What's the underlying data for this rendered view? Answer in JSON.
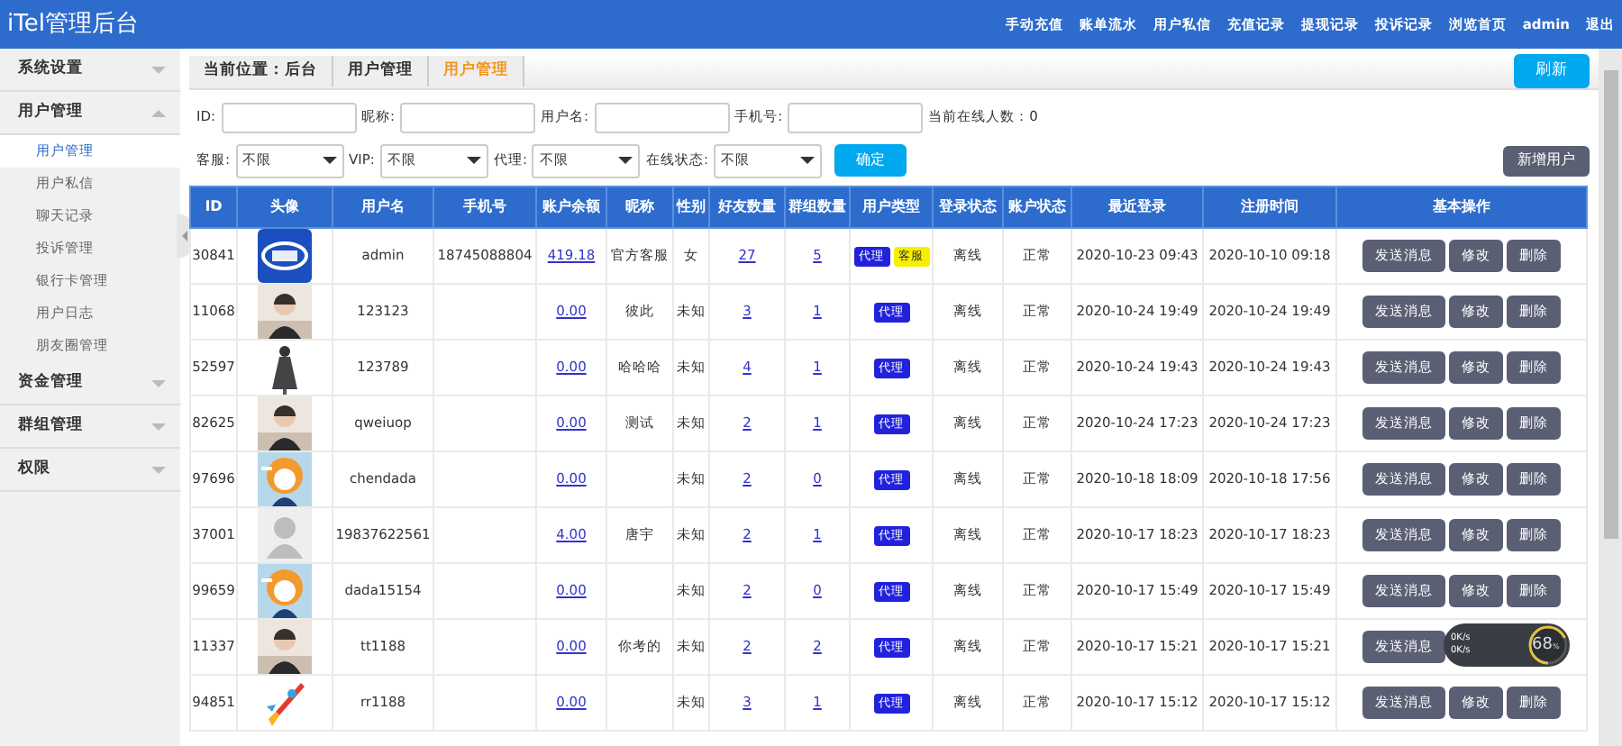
{
  "header": {
    "title": "iTel管理后台",
    "links": [
      "手动充值",
      "账单流水",
      "用户私信",
      "充值记录",
      "提现记录",
      "投诉记录",
      "浏览首页",
      "admin",
      "退出"
    ]
  },
  "sidebar": [
    {
      "label": "系统设置",
      "expanded": false
    },
    {
      "label": "用户管理",
      "expanded": true,
      "children": [
        {
          "label": "用户管理",
          "selected": true
        },
        {
          "label": "用户私信",
          "selected": false
        },
        {
          "label": "聊天记录",
          "selected": false
        },
        {
          "label": "投诉管理",
          "selected": false
        },
        {
          "label": "银行卡管理",
          "selected": false
        },
        {
          "label": "用户日志",
          "selected": false
        },
        {
          "label": "朋友圈管理",
          "selected": false
        }
      ]
    },
    {
      "label": "资金管理",
      "expanded": false
    },
    {
      "label": "群组管理",
      "expanded": false
    },
    {
      "label": "权限",
      "expanded": false
    }
  ],
  "breadcrumb": [
    "当前位置：后台",
    "用户管理",
    "用户管理"
  ],
  "refresh_button": "刷新",
  "filters": {
    "inputs": [
      {
        "label": "ID:"
      },
      {
        "label": "昵称:"
      },
      {
        "label": "用户名:"
      },
      {
        "label": "手机号:"
      }
    ],
    "online_count": "当前在线人数：0",
    "selects": [
      {
        "label": "客服:",
        "value": "不限"
      },
      {
        "label": "VIP:",
        "value": "不限"
      },
      {
        "label": "代理:",
        "value": "不限"
      },
      {
        "label": "在线状态:",
        "value": "不限"
      }
    ],
    "confirm_button": "确定"
  },
  "add_button": "新增用户",
  "table": {
    "columns": [
      "ID",
      "头像",
      "用户名",
      "手机号",
      "账户余额",
      "昵称",
      "性别",
      "好友数量",
      "群组数量",
      "用户类型",
      "登录状态",
      "账户状态",
      "最近登录",
      "注册时间",
      "基本操作"
    ],
    "rows": [
      {
        "id": "30841",
        "avatar": {
          "kind": "picture"
        },
        "username": "admin",
        "phone": "18745088804",
        "balance": "419.18",
        "nickname": "官方客服",
        "gender": "女",
        "friends": "27",
        "groups": "5",
        "types": [
          {
            "label": "代理",
            "kind": "agent"
          },
          {
            "label": "客服",
            "kind": "service"
          }
        ],
        "login": "离线",
        "status": "正常",
        "last_login": "2020-10-23 09:43",
        "registered": "2020-10-10 09:18",
        "actions": [
          "发送消息",
          "修改",
          "删除"
        ]
      },
      {
        "id": "11068",
        "avatar": {
          "kind": "picture"
        },
        "username": "123123",
        "balance": "0.00",
        "nickname": "彼此",
        "gender": "未知",
        "friends": "3",
        "groups": "1",
        "types": [
          {
            "label": "代理",
            "kind": "agent"
          }
        ],
        "login": "离线",
        "status": "正常",
        "last_login": "2020-10-24 19:49",
        "registered": "2020-10-24 19:49",
        "actions": [
          "发送消息",
          "修改",
          "删除"
        ]
      },
      {
        "id": "52597",
        "avatar": {
          "kind": "picture"
        },
        "username": "123789",
        "balance": "0.00",
        "nickname": "哈哈哈",
        "gender": "未知",
        "friends": "4",
        "groups": "1",
        "types": [
          {
            "label": "代理",
            "kind": "agent"
          }
        ],
        "login": "离线",
        "status": "正常",
        "last_login": "2020-10-24 19:43",
        "registered": "2020-10-24 19:43",
        "actions": [
          "发送消息",
          "修改",
          "删除"
        ]
      },
      {
        "id": "82625",
        "avatar": {
          "kind": "picture"
        },
        "username": "qweiuop",
        "balance": "0.00",
        "nickname": "测试",
        "gender": "未知",
        "friends": "2",
        "groups": "1",
        "types": [
          {
            "label": "代理",
            "kind": "agent"
          }
        ],
        "login": "离线",
        "status": "正常",
        "last_login": "2020-10-24 17:23",
        "registered": "2020-10-24 17:23",
        "actions": [
          "发送消息",
          "修改",
          "删除"
        ]
      },
      {
        "id": "97696",
        "avatar": {
          "kind": "picture"
        },
        "username": "chendada",
        "balance": "0.00",
        "gender": "未知",
        "friends": "2",
        "groups": "0",
        "types": [
          {
            "label": "代理",
            "kind": "agent"
          }
        ],
        "login": "离线",
        "status": "正常",
        "last_login": "2020-10-18 18:09",
        "registered": "2020-10-18 17:56",
        "actions": [
          "发送消息",
          "修改",
          "删除"
        ]
      },
      {
        "id": "37001",
        "avatar": {
          "kind": "default"
        },
        "username": "19837622561",
        "balance": "4.00",
        "nickname": "唐宇",
        "gender": "未知",
        "friends": "2",
        "groups": "1",
        "types": [
          {
            "label": "代理",
            "kind": "agent"
          }
        ],
        "login": "离线",
        "status": "正常",
        "last_login": "2020-10-17 18:23",
        "registered": "2020-10-17 18:23",
        "actions": [
          "发送消息",
          "修改",
          "删除"
        ]
      },
      {
        "id": "99659",
        "avatar": {
          "kind": "picture"
        },
        "username": "dada15154",
        "balance": "0.00",
        "gender": "未知",
        "friends": "2",
        "groups": "0",
        "types": [
          {
            "label": "代理",
            "kind": "agent"
          }
        ],
        "login": "离线",
        "status": "正常",
        "last_login": "2020-10-17 15:49",
        "registered": "2020-10-17 15:49",
        "actions": [
          "发送消息",
          "修改",
          "删除"
        ]
      },
      {
        "id": "11337",
        "avatar": {
          "kind": "picture"
        },
        "username": "tt1188",
        "balance": "0.00",
        "nickname": "你考的",
        "gender": "未知",
        "friends": "2",
        "groups": "2",
        "types": [
          {
            "label": "代理",
            "kind": "agent"
          }
        ],
        "login": "离线",
        "status": "正常",
        "last_login": "2020-10-17 15:21",
        "registered": "2020-10-17 15:21",
        "actions": [
          "发送消息"
        ]
      },
      {
        "id": "94851",
        "avatar": {
          "kind": "picture"
        },
        "username": "rr1188",
        "balance": "0.00",
        "gender": "未知",
        "friends": "3",
        "groups": "1",
        "types": [
          {
            "label": "代理",
            "kind": "agent"
          }
        ],
        "login": "离线",
        "status": "正常",
        "last_login": "2020-10-17 15:12",
        "registered": "2020-10-17 15:12",
        "actions": [
          "发送消息",
          "修改",
          "删除"
        ]
      }
    ]
  },
  "speed_widget": {
    "upload": "0K/s",
    "download": "0K/s",
    "value": "68",
    "unit": "%"
  }
}
